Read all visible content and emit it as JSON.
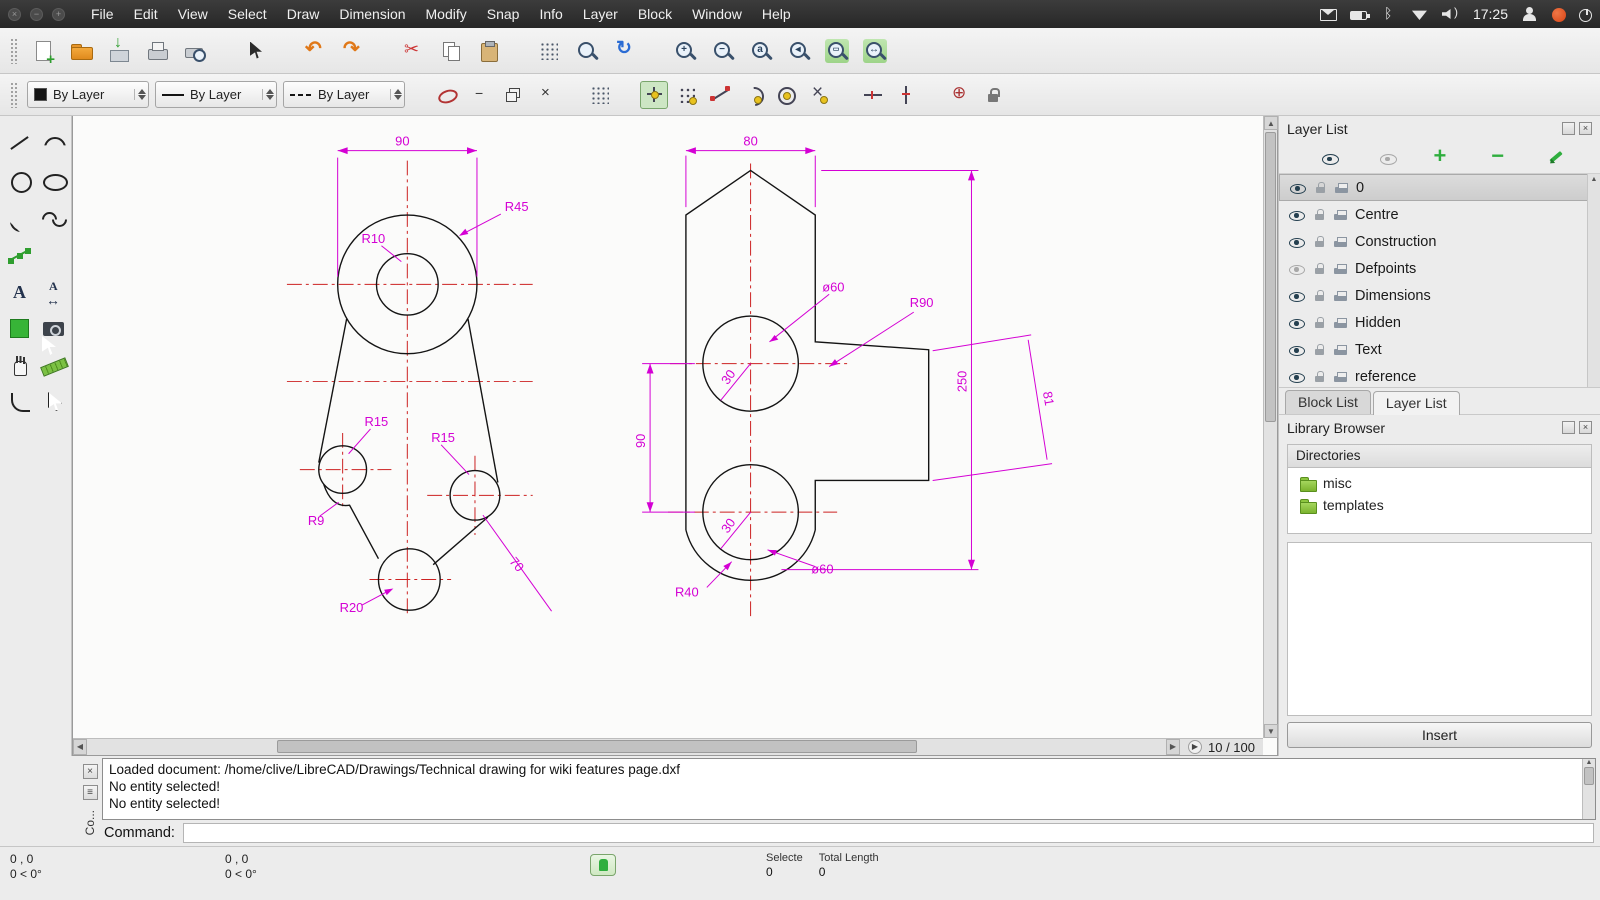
{
  "titlebar": {
    "clock": "17:25"
  },
  "menubar": {
    "items": [
      "File",
      "Edit",
      "View",
      "Select",
      "Draw",
      "Dimension",
      "Modify",
      "Snap",
      "Info",
      "Layer",
      "Block",
      "Window",
      "Help"
    ]
  },
  "toolbars": {
    "file": [
      {
        "icon": "new-document"
      },
      {
        "icon": "open-file"
      },
      {
        "icon": "save-file"
      },
      {
        "icon": "print"
      },
      {
        "icon": "print-preview"
      },
      {
        "sep": true
      },
      {
        "icon": "select-pointer"
      },
      {
        "sep": true
      },
      {
        "icon": "undo"
      },
      {
        "icon": "redo"
      },
      {
        "sep": true
      },
      {
        "icon": "cut"
      },
      {
        "icon": "copy"
      },
      {
        "icon": "paste"
      },
      {
        "sep": true
      },
      {
        "icon": "grid"
      },
      {
        "icon": "zoom"
      },
      {
        "icon": "redraw"
      },
      {
        "sep": true
      },
      {
        "icon": "zoom-in"
      },
      {
        "icon": "zoom-out"
      },
      {
        "icon": "zoom-auto"
      },
      {
        "icon": "zoom-previous"
      },
      {
        "icon": "zoom-window"
      },
      {
        "icon": "zoom-pan"
      }
    ],
    "snap": [
      {
        "icon": "document-window"
      },
      {
        "icon": "mdi-minimize"
      },
      {
        "icon": "mdi-restore"
      },
      {
        "icon": "mdi-close"
      },
      {
        "sep": true
      },
      {
        "icon": "grid-toggle"
      },
      {
        "sep": true
      },
      {
        "icon": "snap-free",
        "active": true
      },
      {
        "icon": "snap-grid"
      },
      {
        "icon": "snap-endpoint"
      },
      {
        "icon": "snap-on-entity"
      },
      {
        "icon": "snap-center"
      },
      {
        "icon": "snap-intersection"
      },
      {
        "sep": true
      },
      {
        "icon": "restrict-horizontal"
      },
      {
        "icon": "restrict-vertical"
      },
      {
        "sep": true
      },
      {
        "icon": "set-relative-zero"
      },
      {
        "icon": "lock-relative-zero"
      }
    ],
    "layer": [
      "show-all-layers",
      "hide-all-layers",
      "add-layer",
      "remove-layer",
      "edit-layer"
    ]
  },
  "pen": {
    "color": "By Layer",
    "width": "By Layer",
    "linetype": "By Layer"
  },
  "tool_palette": [
    [
      "line",
      "arc"
    ],
    [
      "circle",
      "ellipse"
    ],
    [
      "curve",
      "spline"
    ],
    [
      "polyline",
      ""
    ],
    [
      "text",
      "dimension"
    ],
    [
      "hatch",
      "image"
    ],
    [
      "pan",
      "measure"
    ],
    [
      "fillet",
      "select"
    ]
  ],
  "drawing": {
    "left": {
      "width": "90",
      "r45": "R45",
      "r10": "R10",
      "r15_left": "R15",
      "r15_right": "R15",
      "r9": "R9",
      "r20": "R20",
      "len70": "70"
    },
    "right": {
      "width": "80",
      "dia60_top": "ø60",
      "r90": "R90",
      "height250": "250",
      "len81": "81",
      "height90": "90",
      "rad30_top": "30",
      "rad30_bottom": "30",
      "r40": "R40",
      "dia60_bottom": "ø60"
    }
  },
  "canvas": {
    "page_indicator": "10 / 100"
  },
  "layer_panel": {
    "title": "Layer List",
    "layers": [
      {
        "name": "0",
        "selected": true,
        "visible": true
      },
      {
        "name": "Centre",
        "visible": true
      },
      {
        "name": "Construction",
        "visible": true
      },
      {
        "name": "Defpoints",
        "visible": false
      },
      {
        "name": "Dimensions",
        "visible": true
      },
      {
        "name": "Hidden",
        "visible": true
      },
      {
        "name": "Text",
        "visible": true
      },
      {
        "name": "reference",
        "visible": true
      }
    ]
  },
  "tabs": {
    "block": "Block List",
    "layer": "Layer List"
  },
  "library_panel": {
    "title": "Library Browser",
    "directories_label": "Directories",
    "folders": [
      "misc",
      "templates"
    ],
    "insert_label": "Insert"
  },
  "console": {
    "dock_label": "Co...",
    "lines": [
      "Loaded document: /home/clive/LibreCAD/Drawings/Technical drawing for wiki features page.dxf",
      "No entity selected!",
      "No entity selected!"
    ],
    "prompt": "Command:"
  },
  "statusbar": {
    "abs_pos": "0 , 0",
    "abs_angle": "0 < 0°",
    "rel_pos": "0 , 0",
    "rel_angle": "0 < 0°",
    "selected_label": "Selecte",
    "selected_value": "0",
    "total_label": "Total Length",
    "total_value": "0"
  }
}
